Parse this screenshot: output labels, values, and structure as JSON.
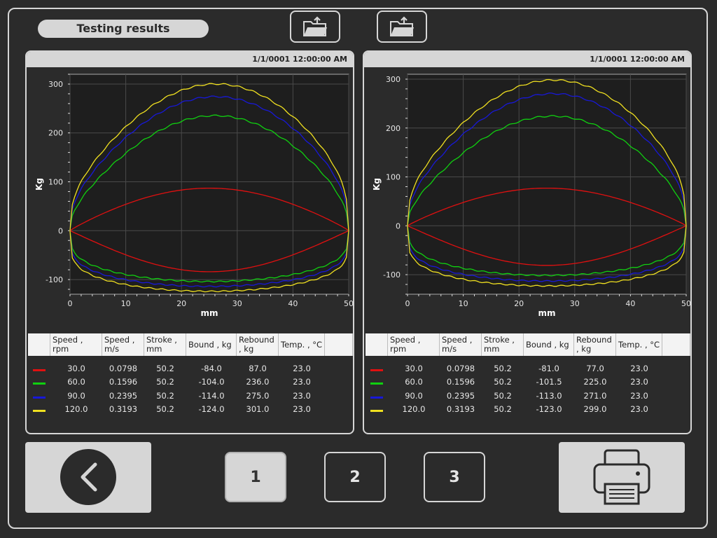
{
  "header": {
    "title": "Testing results"
  },
  "toolbar": {
    "open_left_icon": "folder-upload-icon",
    "open_right_icon": "folder-upload-icon"
  },
  "panels": [
    {
      "timestamp": "1/1/0001 12:00:00 AM",
      "table": {
        "columns": [
          "Speed , rpm",
          "Speed , m/s",
          "Stroke , mm",
          "Bound , kg",
          "Rebound , kg",
          "Temp. , °C"
        ],
        "rows": [
          {
            "color": "#e01010",
            "speed_rpm": "30.0",
            "speed_ms": "0.0798",
            "stroke": "50.2",
            "bound": "-84.0",
            "rebound": "87.0",
            "temp": "23.0"
          },
          {
            "color": "#10d010",
            "speed_rpm": "60.0",
            "speed_ms": "0.1596",
            "stroke": "50.2",
            "bound": "-104.0",
            "rebound": "236.0",
            "temp": "23.0"
          },
          {
            "color": "#1818d8",
            "speed_rpm": "90.0",
            "speed_ms": "0.2395",
            "stroke": "50.2",
            "bound": "-114.0",
            "rebound": "275.0",
            "temp": "23.0"
          },
          {
            "color": "#f0e020",
            "speed_rpm": "120.0",
            "speed_ms": "0.3193",
            "stroke": "50.2",
            "bound": "-124.0",
            "rebound": "301.0",
            "temp": "23.0"
          }
        ]
      }
    },
    {
      "timestamp": "1/1/0001 12:00:00 AM",
      "table": {
        "columns": [
          "Speed , rpm",
          "Speed , m/s",
          "Stroke , mm",
          "Bound , kg",
          "Rebound , kg",
          "Temp. , °C"
        ],
        "rows": [
          {
            "color": "#e01010",
            "speed_rpm": "30.0",
            "speed_ms": "0.0798",
            "stroke": "50.2",
            "bound": "-81.0",
            "rebound": "77.0",
            "temp": "23.0"
          },
          {
            "color": "#10d010",
            "speed_rpm": "60.0",
            "speed_ms": "0.1596",
            "stroke": "50.2",
            "bound": "-101.5",
            "rebound": "225.0",
            "temp": "23.0"
          },
          {
            "color": "#1818d8",
            "speed_rpm": "90.0",
            "speed_ms": "0.2395",
            "stroke": "50.2",
            "bound": "-113.0",
            "rebound": "271.0",
            "temp": "23.0"
          },
          {
            "color": "#f0e020",
            "speed_rpm": "120.0",
            "speed_ms": "0.3193",
            "stroke": "50.2",
            "bound": "-123.0",
            "rebound": "299.0",
            "temp": "23.0"
          }
        ]
      }
    }
  ],
  "chart_data": [
    {
      "type": "line",
      "xlabel": "mm",
      "ylabel": "Kg",
      "xlim": [
        0,
        50
      ],
      "ylim": [
        -130,
        320
      ],
      "xticks": [
        0,
        10,
        20,
        30,
        40,
        50
      ],
      "yticks": [
        -100,
        0,
        100,
        200,
        300
      ],
      "grid": true,
      "series": [
        {
          "color": "#e01010",
          "rebound": 87,
          "bound": -84,
          "peak_x": 27
        },
        {
          "color": "#10d010",
          "rebound": 236,
          "bound": -104,
          "peak_x": 28
        },
        {
          "color": "#1818d8",
          "rebound": 275,
          "bound": -114,
          "peak_x": 28
        },
        {
          "color": "#f0e020",
          "rebound": 301,
          "bound": -124,
          "peak_x": 28
        }
      ]
    },
    {
      "type": "line",
      "xlabel": "mm",
      "ylabel": "Kg",
      "xlim": [
        0,
        50
      ],
      "ylim": [
        -140,
        310
      ],
      "xticks": [
        0,
        10,
        20,
        30,
        40,
        50
      ],
      "yticks": [
        -100,
        0,
        100,
        200,
        300
      ],
      "grid": true,
      "series": [
        {
          "color": "#e01010",
          "rebound": 77,
          "bound": -81,
          "peak_x": 27
        },
        {
          "color": "#10d010",
          "rebound": 225,
          "bound": -101.5,
          "peak_x": 28
        },
        {
          "color": "#1818d8",
          "rebound": 271,
          "bound": -113,
          "peak_x": 28
        },
        {
          "color": "#f0e020",
          "rebound": 299,
          "bound": -123,
          "peak_x": 28
        }
      ]
    }
  ],
  "pagination": {
    "pages": [
      "1",
      "2",
      "3"
    ],
    "active": "1"
  },
  "actions": {
    "back_icon": "chevron-left-icon",
    "print_icon": "printer-icon"
  }
}
